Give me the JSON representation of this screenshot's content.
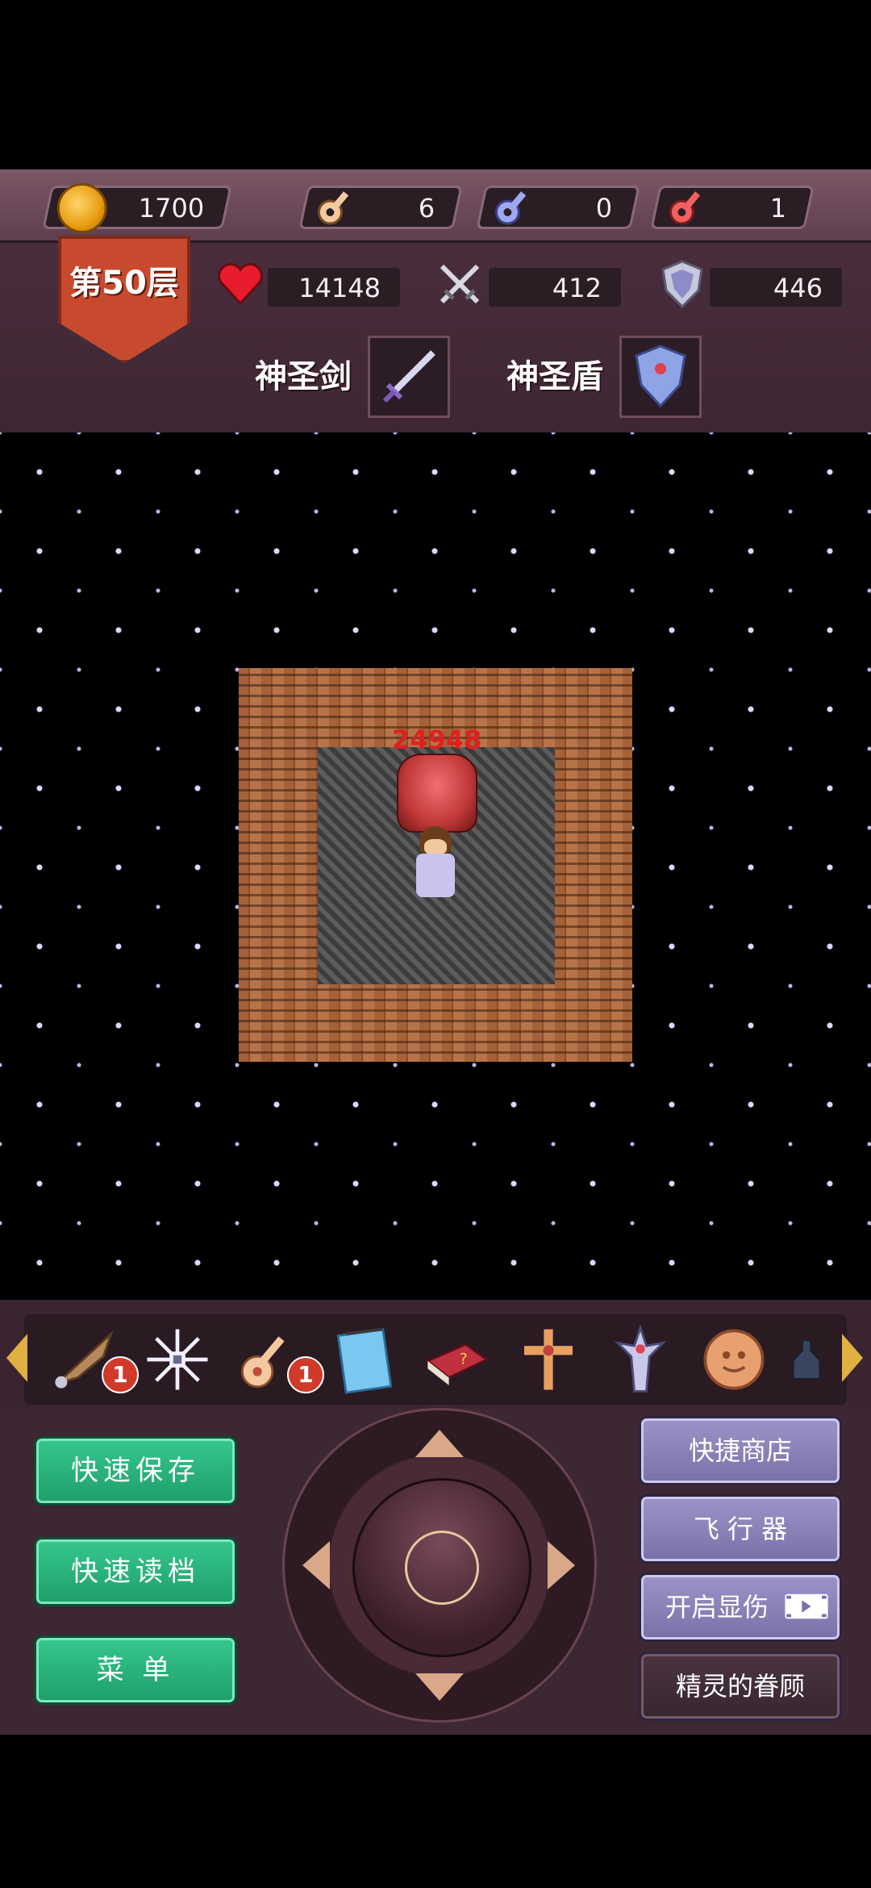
{
  "resources": {
    "gold": "1700",
    "yellow_keys": "6",
    "blue_keys": "0",
    "red_keys": "1"
  },
  "floor": "第50层",
  "stats": {
    "hp": "14148",
    "attack": "412",
    "defense": "446"
  },
  "equipment": {
    "weapon": "神圣剑",
    "armor": "神圣盾"
  },
  "map": {
    "damage_label": "24948"
  },
  "items": [
    {
      "name": "wing-icon",
      "badge": "1"
    },
    {
      "name": "snowflake-icon",
      "badge": ""
    },
    {
      "name": "key-icon",
      "badge": "1"
    },
    {
      "name": "notepad-icon",
      "badge": ""
    },
    {
      "name": "book-icon",
      "badge": ""
    },
    {
      "name": "cross-icon",
      "badge": ""
    },
    {
      "name": "holy-cross-icon",
      "badge": ""
    },
    {
      "name": "coin-icon",
      "badge": ""
    },
    {
      "name": "bottle-icon",
      "badge": ""
    }
  ],
  "buttons": {
    "quick_save": "快速保存",
    "quick_load": "快速读档",
    "menu": "菜  单",
    "quick_shop": "快捷商店",
    "flyer": "飞 行 器",
    "show_damage": "开启显伤",
    "spirit_favor": "精灵的眷顾"
  },
  "colors": {
    "green_button": "#1f9e6a",
    "purple_button": "#7a70a8",
    "damage_red": "#e02020"
  }
}
